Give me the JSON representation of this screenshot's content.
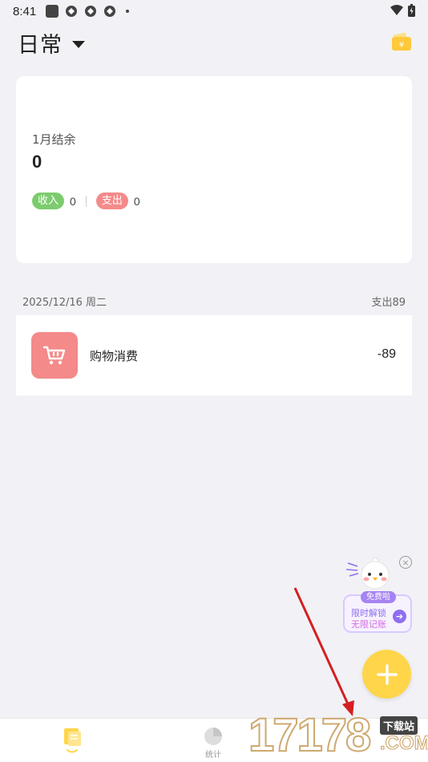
{
  "status_bar": {
    "time": "8:41"
  },
  "header": {
    "book_title": "日常"
  },
  "summary": {
    "balance_label": "1月结余",
    "balance_value": "0",
    "income_label": "收入",
    "income_value": "0",
    "expense_label": "支出",
    "expense_value": "0"
  },
  "day_group": {
    "date": "2025/12/16 周二",
    "total": "支出89",
    "records": [
      {
        "category": "购物消费",
        "amount": "-89",
        "icon": "shopping-cart-icon"
      }
    ]
  },
  "promo": {
    "badge": "免费啦",
    "line1": "限时解锁",
    "line2": "无限记账"
  },
  "bottom_nav": {
    "items": [
      {
        "label": "",
        "icon": "ledger-icon"
      },
      {
        "label": "统计",
        "icon": "pie-chart-icon"
      }
    ]
  },
  "watermark": {
    "number": "17178",
    "tag": "下载站",
    "domain": ".COM"
  },
  "colors": {
    "background": "#f2f2f6",
    "accent_yellow": "#ffd54a",
    "income_green": "#7ccc6e",
    "expense_red": "#f58a8a",
    "promo_purple": "#8f6ef0"
  }
}
